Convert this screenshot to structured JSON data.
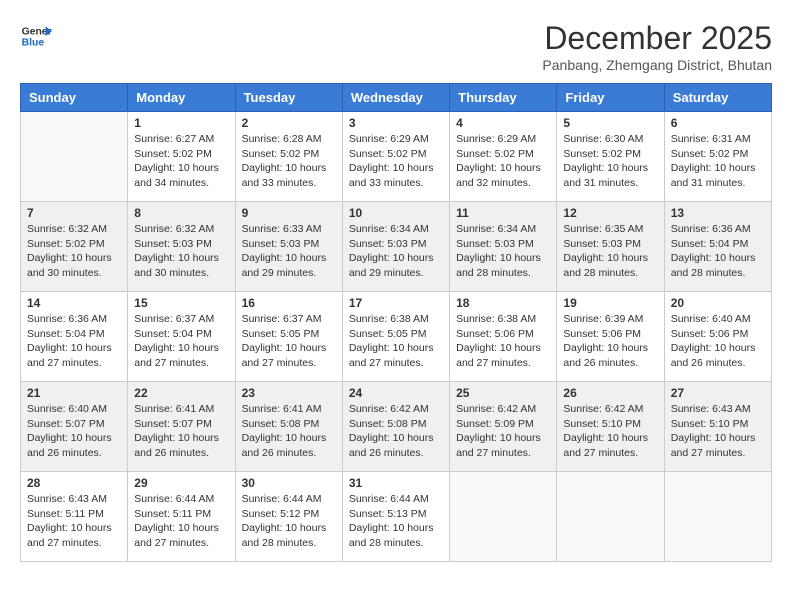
{
  "header": {
    "logo_line1": "General",
    "logo_line2": "Blue",
    "month_title": "December 2025",
    "location": "Panbang, Zhemgang District, Bhutan"
  },
  "days_of_week": [
    "Sunday",
    "Monday",
    "Tuesday",
    "Wednesday",
    "Thursday",
    "Friday",
    "Saturday"
  ],
  "weeks": [
    [
      {
        "day": "",
        "sunrise": "",
        "sunset": "",
        "daylight": ""
      },
      {
        "day": "1",
        "sunrise": "Sunrise: 6:27 AM",
        "sunset": "Sunset: 5:02 PM",
        "daylight": "Daylight: 10 hours and 34 minutes."
      },
      {
        "day": "2",
        "sunrise": "Sunrise: 6:28 AM",
        "sunset": "Sunset: 5:02 PM",
        "daylight": "Daylight: 10 hours and 33 minutes."
      },
      {
        "day": "3",
        "sunrise": "Sunrise: 6:29 AM",
        "sunset": "Sunset: 5:02 PM",
        "daylight": "Daylight: 10 hours and 33 minutes."
      },
      {
        "day": "4",
        "sunrise": "Sunrise: 6:29 AM",
        "sunset": "Sunset: 5:02 PM",
        "daylight": "Daylight: 10 hours and 32 minutes."
      },
      {
        "day": "5",
        "sunrise": "Sunrise: 6:30 AM",
        "sunset": "Sunset: 5:02 PM",
        "daylight": "Daylight: 10 hours and 31 minutes."
      },
      {
        "day": "6",
        "sunrise": "Sunrise: 6:31 AM",
        "sunset": "Sunset: 5:02 PM",
        "daylight": "Daylight: 10 hours and 31 minutes."
      }
    ],
    [
      {
        "day": "7",
        "sunrise": "Sunrise: 6:32 AM",
        "sunset": "Sunset: 5:02 PM",
        "daylight": "Daylight: 10 hours and 30 minutes."
      },
      {
        "day": "8",
        "sunrise": "Sunrise: 6:32 AM",
        "sunset": "Sunset: 5:03 PM",
        "daylight": "Daylight: 10 hours and 30 minutes."
      },
      {
        "day": "9",
        "sunrise": "Sunrise: 6:33 AM",
        "sunset": "Sunset: 5:03 PM",
        "daylight": "Daylight: 10 hours and 29 minutes."
      },
      {
        "day": "10",
        "sunrise": "Sunrise: 6:34 AM",
        "sunset": "Sunset: 5:03 PM",
        "daylight": "Daylight: 10 hours and 29 minutes."
      },
      {
        "day": "11",
        "sunrise": "Sunrise: 6:34 AM",
        "sunset": "Sunset: 5:03 PM",
        "daylight": "Daylight: 10 hours and 28 minutes."
      },
      {
        "day": "12",
        "sunrise": "Sunrise: 6:35 AM",
        "sunset": "Sunset: 5:03 PM",
        "daylight": "Daylight: 10 hours and 28 minutes."
      },
      {
        "day": "13",
        "sunrise": "Sunrise: 6:36 AM",
        "sunset": "Sunset: 5:04 PM",
        "daylight": "Daylight: 10 hours and 28 minutes."
      }
    ],
    [
      {
        "day": "14",
        "sunrise": "Sunrise: 6:36 AM",
        "sunset": "Sunset: 5:04 PM",
        "daylight": "Daylight: 10 hours and 27 minutes."
      },
      {
        "day": "15",
        "sunrise": "Sunrise: 6:37 AM",
        "sunset": "Sunset: 5:04 PM",
        "daylight": "Daylight: 10 hours and 27 minutes."
      },
      {
        "day": "16",
        "sunrise": "Sunrise: 6:37 AM",
        "sunset": "Sunset: 5:05 PM",
        "daylight": "Daylight: 10 hours and 27 minutes."
      },
      {
        "day": "17",
        "sunrise": "Sunrise: 6:38 AM",
        "sunset": "Sunset: 5:05 PM",
        "daylight": "Daylight: 10 hours and 27 minutes."
      },
      {
        "day": "18",
        "sunrise": "Sunrise: 6:38 AM",
        "sunset": "Sunset: 5:06 PM",
        "daylight": "Daylight: 10 hours and 27 minutes."
      },
      {
        "day": "19",
        "sunrise": "Sunrise: 6:39 AM",
        "sunset": "Sunset: 5:06 PM",
        "daylight": "Daylight: 10 hours and 26 minutes."
      },
      {
        "day": "20",
        "sunrise": "Sunrise: 6:40 AM",
        "sunset": "Sunset: 5:06 PM",
        "daylight": "Daylight: 10 hours and 26 minutes."
      }
    ],
    [
      {
        "day": "21",
        "sunrise": "Sunrise: 6:40 AM",
        "sunset": "Sunset: 5:07 PM",
        "daylight": "Daylight: 10 hours and 26 minutes."
      },
      {
        "day": "22",
        "sunrise": "Sunrise: 6:41 AM",
        "sunset": "Sunset: 5:07 PM",
        "daylight": "Daylight: 10 hours and 26 minutes."
      },
      {
        "day": "23",
        "sunrise": "Sunrise: 6:41 AM",
        "sunset": "Sunset: 5:08 PM",
        "daylight": "Daylight: 10 hours and 26 minutes."
      },
      {
        "day": "24",
        "sunrise": "Sunrise: 6:42 AM",
        "sunset": "Sunset: 5:08 PM",
        "daylight": "Daylight: 10 hours and 26 minutes."
      },
      {
        "day": "25",
        "sunrise": "Sunrise: 6:42 AM",
        "sunset": "Sunset: 5:09 PM",
        "daylight": "Daylight: 10 hours and 27 minutes."
      },
      {
        "day": "26",
        "sunrise": "Sunrise: 6:42 AM",
        "sunset": "Sunset: 5:10 PM",
        "daylight": "Daylight: 10 hours and 27 minutes."
      },
      {
        "day": "27",
        "sunrise": "Sunrise: 6:43 AM",
        "sunset": "Sunset: 5:10 PM",
        "daylight": "Daylight: 10 hours and 27 minutes."
      }
    ],
    [
      {
        "day": "28",
        "sunrise": "Sunrise: 6:43 AM",
        "sunset": "Sunset: 5:11 PM",
        "daylight": "Daylight: 10 hours and 27 minutes."
      },
      {
        "day": "29",
        "sunrise": "Sunrise: 6:44 AM",
        "sunset": "Sunset: 5:11 PM",
        "daylight": "Daylight: 10 hours and 27 minutes."
      },
      {
        "day": "30",
        "sunrise": "Sunrise: 6:44 AM",
        "sunset": "Sunset: 5:12 PM",
        "daylight": "Daylight: 10 hours and 28 minutes."
      },
      {
        "day": "31",
        "sunrise": "Sunrise: 6:44 AM",
        "sunset": "Sunset: 5:13 PM",
        "daylight": "Daylight: 10 hours and 28 minutes."
      },
      {
        "day": "",
        "sunrise": "",
        "sunset": "",
        "daylight": ""
      },
      {
        "day": "",
        "sunrise": "",
        "sunset": "",
        "daylight": ""
      },
      {
        "day": "",
        "sunrise": "",
        "sunset": "",
        "daylight": ""
      }
    ]
  ]
}
